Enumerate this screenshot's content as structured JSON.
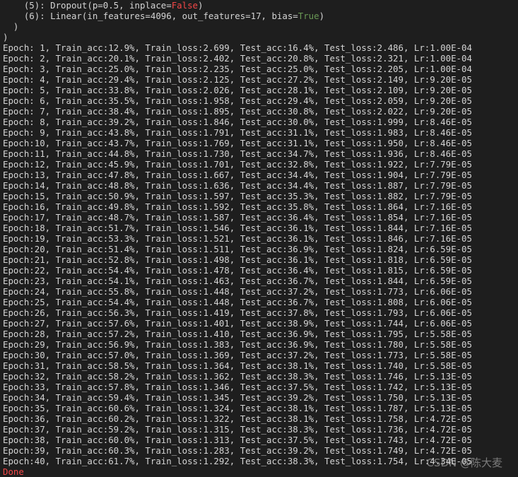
{
  "colors": {
    "background": "#1e1e1e",
    "text": "#d4d4d4",
    "false_keyword": "#f44747",
    "true_keyword": "#6a9955"
  },
  "header": {
    "dropout_prefix": "    (5): Dropout(p=0.5, inplace=",
    "dropout_value": "False",
    "dropout_suffix": ")",
    "linear_prefix": "    (6): Linear(in_features=4096, out_features=17, bias=",
    "linear_value": "True",
    "linear_suffix": ")",
    "close1": "  )",
    "close2": ")"
  },
  "log_lines": [
    "Epoch: 1, Train_acc:12.9%, Train_loss:2.699, Test_acc:16.4%, Test_loss:2.486, Lr:1.00E-04",
    "Epoch: 2, Train_acc:20.1%, Train_loss:2.402, Test_acc:20.8%, Test_loss:2.321, Lr:1.00E-04",
    "Epoch: 3, Train_acc:25.0%, Train_loss:2.235, Test_acc:25.0%, Test_loss:2.205, Lr:1.00E-04",
    "Epoch: 4, Train_acc:29.4%, Train_loss:2.125, Test_acc:27.2%, Test_loss:2.149, Lr:9.20E-05",
    "Epoch: 5, Train_acc:33.8%, Train_loss:2.026, Test_acc:28.1%, Test_loss:2.109, Lr:9.20E-05",
    "Epoch: 6, Train_acc:35.5%, Train_loss:1.958, Test_acc:29.4%, Test_loss:2.059, Lr:9.20E-05",
    "Epoch: 7, Train_acc:38.4%, Train_loss:1.895, Test_acc:30.8%, Test_loss:2.022, Lr:9.20E-05",
    "Epoch: 8, Train_acc:39.2%, Train_loss:1.846, Test_acc:30.0%, Test_loss:1.999, Lr:8.46E-05",
    "Epoch: 9, Train_acc:43.8%, Train_loss:1.791, Test_acc:31.1%, Test_loss:1.983, Lr:8.46E-05",
    "Epoch:10, Train_acc:43.7%, Train_loss:1.769, Test_acc:31.1%, Test_loss:1.950, Lr:8.46E-05",
    "Epoch:11, Train_acc:44.8%, Train_loss:1.730, Test_acc:34.7%, Test_loss:1.936, Lr:8.46E-05",
    "Epoch:12, Train_acc:45.9%, Train_loss:1.701, Test_acc:32.8%, Test_loss:1.922, Lr:7.79E-05",
    "Epoch:13, Train_acc:47.8%, Train_loss:1.667, Test_acc:34.4%, Test_loss:1.904, Lr:7.79E-05",
    "Epoch:14, Train_acc:48.8%, Train_loss:1.636, Test_acc:34.4%, Test_loss:1.887, Lr:7.79E-05",
    "Epoch:15, Train_acc:50.9%, Train_loss:1.597, Test_acc:35.3%, Test_loss:1.882, Lr:7.79E-05",
    "Epoch:16, Train_acc:49.8%, Train_loss:1.592, Test_acc:35.8%, Test_loss:1.864, Lr:7.16E-05",
    "Epoch:17, Train_acc:48.7%, Train_loss:1.587, Test_acc:36.4%, Test_loss:1.854, Lr:7.16E-05",
    "Epoch:18, Train_acc:51.7%, Train_loss:1.546, Test_acc:36.1%, Test_loss:1.844, Lr:7.16E-05",
    "Epoch:19, Train_acc:53.3%, Train_loss:1.521, Test_acc:36.1%, Test_loss:1.846, Lr:7.16E-05",
    "Epoch:20, Train_acc:51.4%, Train_loss:1.511, Test_acc:36.9%, Test_loss:1.824, Lr:6.59E-05",
    "Epoch:21, Train_acc:52.8%, Train_loss:1.498, Test_acc:36.1%, Test_loss:1.818, Lr:6.59E-05",
    "Epoch:22, Train_acc:54.4%, Train_loss:1.478, Test_acc:36.4%, Test_loss:1.815, Lr:6.59E-05",
    "Epoch:23, Train_acc:54.1%, Train_loss:1.463, Test_acc:36.7%, Test_loss:1.844, Lr:6.59E-05",
    "Epoch:24, Train_acc:55.8%, Train_loss:1.448, Test_acc:37.2%, Test_loss:1.773, Lr:6.06E-05",
    "Epoch:25, Train_acc:54.4%, Train_loss:1.448, Test_acc:36.7%, Test_loss:1.808, Lr:6.06E-05",
    "Epoch:26, Train_acc:56.3%, Train_loss:1.419, Test_acc:37.8%, Test_loss:1.793, Lr:6.06E-05",
    "Epoch:27, Train_acc:57.6%, Train_loss:1.401, Test_acc:38.9%, Test_loss:1.744, Lr:6.06E-05",
    "Epoch:28, Train_acc:57.2%, Train_loss:1.410, Test_acc:36.9%, Test_loss:1.795, Lr:5.58E-05",
    "Epoch:29, Train_acc:56.9%, Train_loss:1.383, Test_acc:36.9%, Test_loss:1.780, Lr:5.58E-05",
    "Epoch:30, Train_acc:57.0%, Train_loss:1.369, Test_acc:37.2%, Test_loss:1.773, Lr:5.58E-05",
    "Epoch:31, Train_acc:58.5%, Train_loss:1.364, Test_acc:38.1%, Test_loss:1.740, Lr:5.58E-05",
    "Epoch:32, Train_acc:58.2%, Train_loss:1.362, Test_acc:38.3%, Test_loss:1.746, Lr:5.13E-05",
    "Epoch:33, Train_acc:57.8%, Train_loss:1.346, Test_acc:37.5%, Test_loss:1.742, Lr:5.13E-05",
    "Epoch:34, Train_acc:59.4%, Train_loss:1.345, Test_acc:39.2%, Test_loss:1.750, Lr:5.13E-05",
    "Epoch:35, Train_acc:60.6%, Train_loss:1.324, Test_acc:38.1%, Test_loss:1.787, Lr:5.13E-05",
    "Epoch:36, Train_acc:60.2%, Train_loss:1.322, Test_acc:38.1%, Test_loss:1.758, Lr:4.72E-05",
    "Epoch:37, Train_acc:59.2%, Train_loss:1.315, Test_acc:38.3%, Test_loss:1.736, Lr:4.72E-05",
    "Epoch:38, Train_acc:60.0%, Train_loss:1.313, Test_acc:37.5%, Test_loss:1.743, Lr:4.72E-05",
    "Epoch:39, Train_acc:60.3%, Train_loss:1.283, Test_acc:39.2%, Test_loss:1.749, Lr:4.72E-05",
    "Epoch:40, Train_acc:61.7%, Train_loss:1.292, Test_acc:38.3%, Test_loss:1.754, Lr:4.34E-05"
  ],
  "footer_status": "Done",
  "watermark": "CSDN @陈大麦"
}
